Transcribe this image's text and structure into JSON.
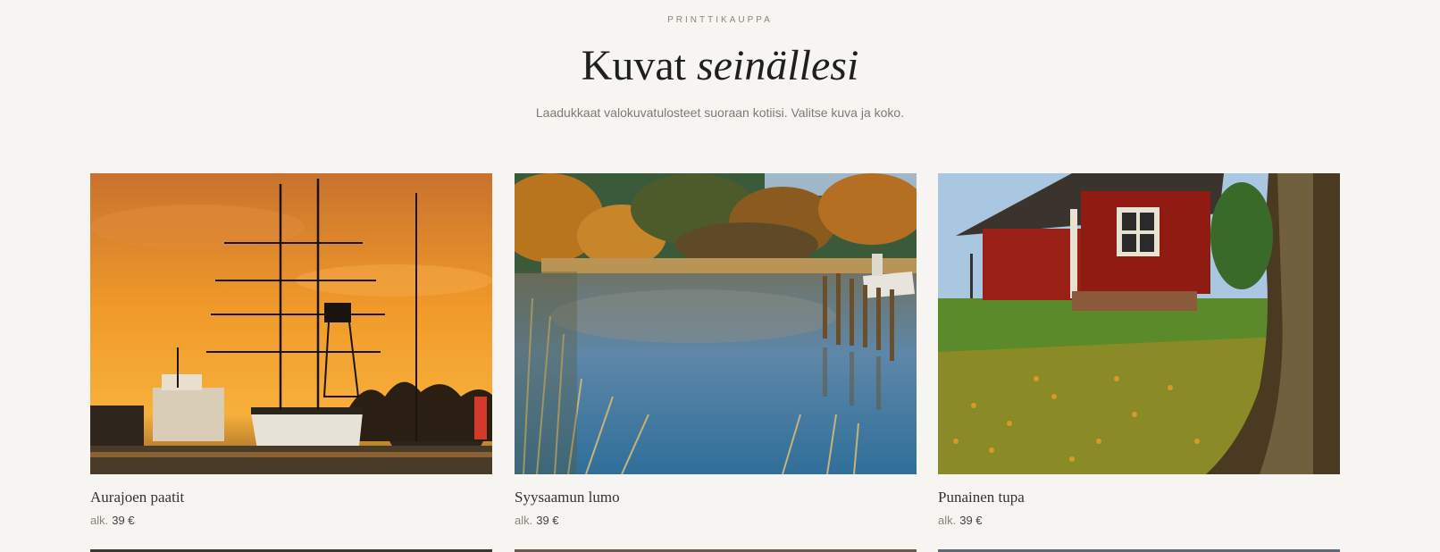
{
  "header": {
    "eyebrow": "PRINTTIKAUPPA",
    "title_plain": "Kuvat",
    "title_italic": "seinällesi",
    "subtitle": "Laadukkaat valokuvatulosteet suoraan kotiisi. Valitse kuva ja koko."
  },
  "products": [
    {
      "name": "Aurajoen paatit",
      "price_prefix": "alk.",
      "price": "39 €"
    },
    {
      "name": "Syysaamun lumo",
      "price_prefix": "alk.",
      "price": "39 €"
    },
    {
      "name": "Punainen tupa",
      "price_prefix": "alk.",
      "price": "39 €"
    }
  ]
}
